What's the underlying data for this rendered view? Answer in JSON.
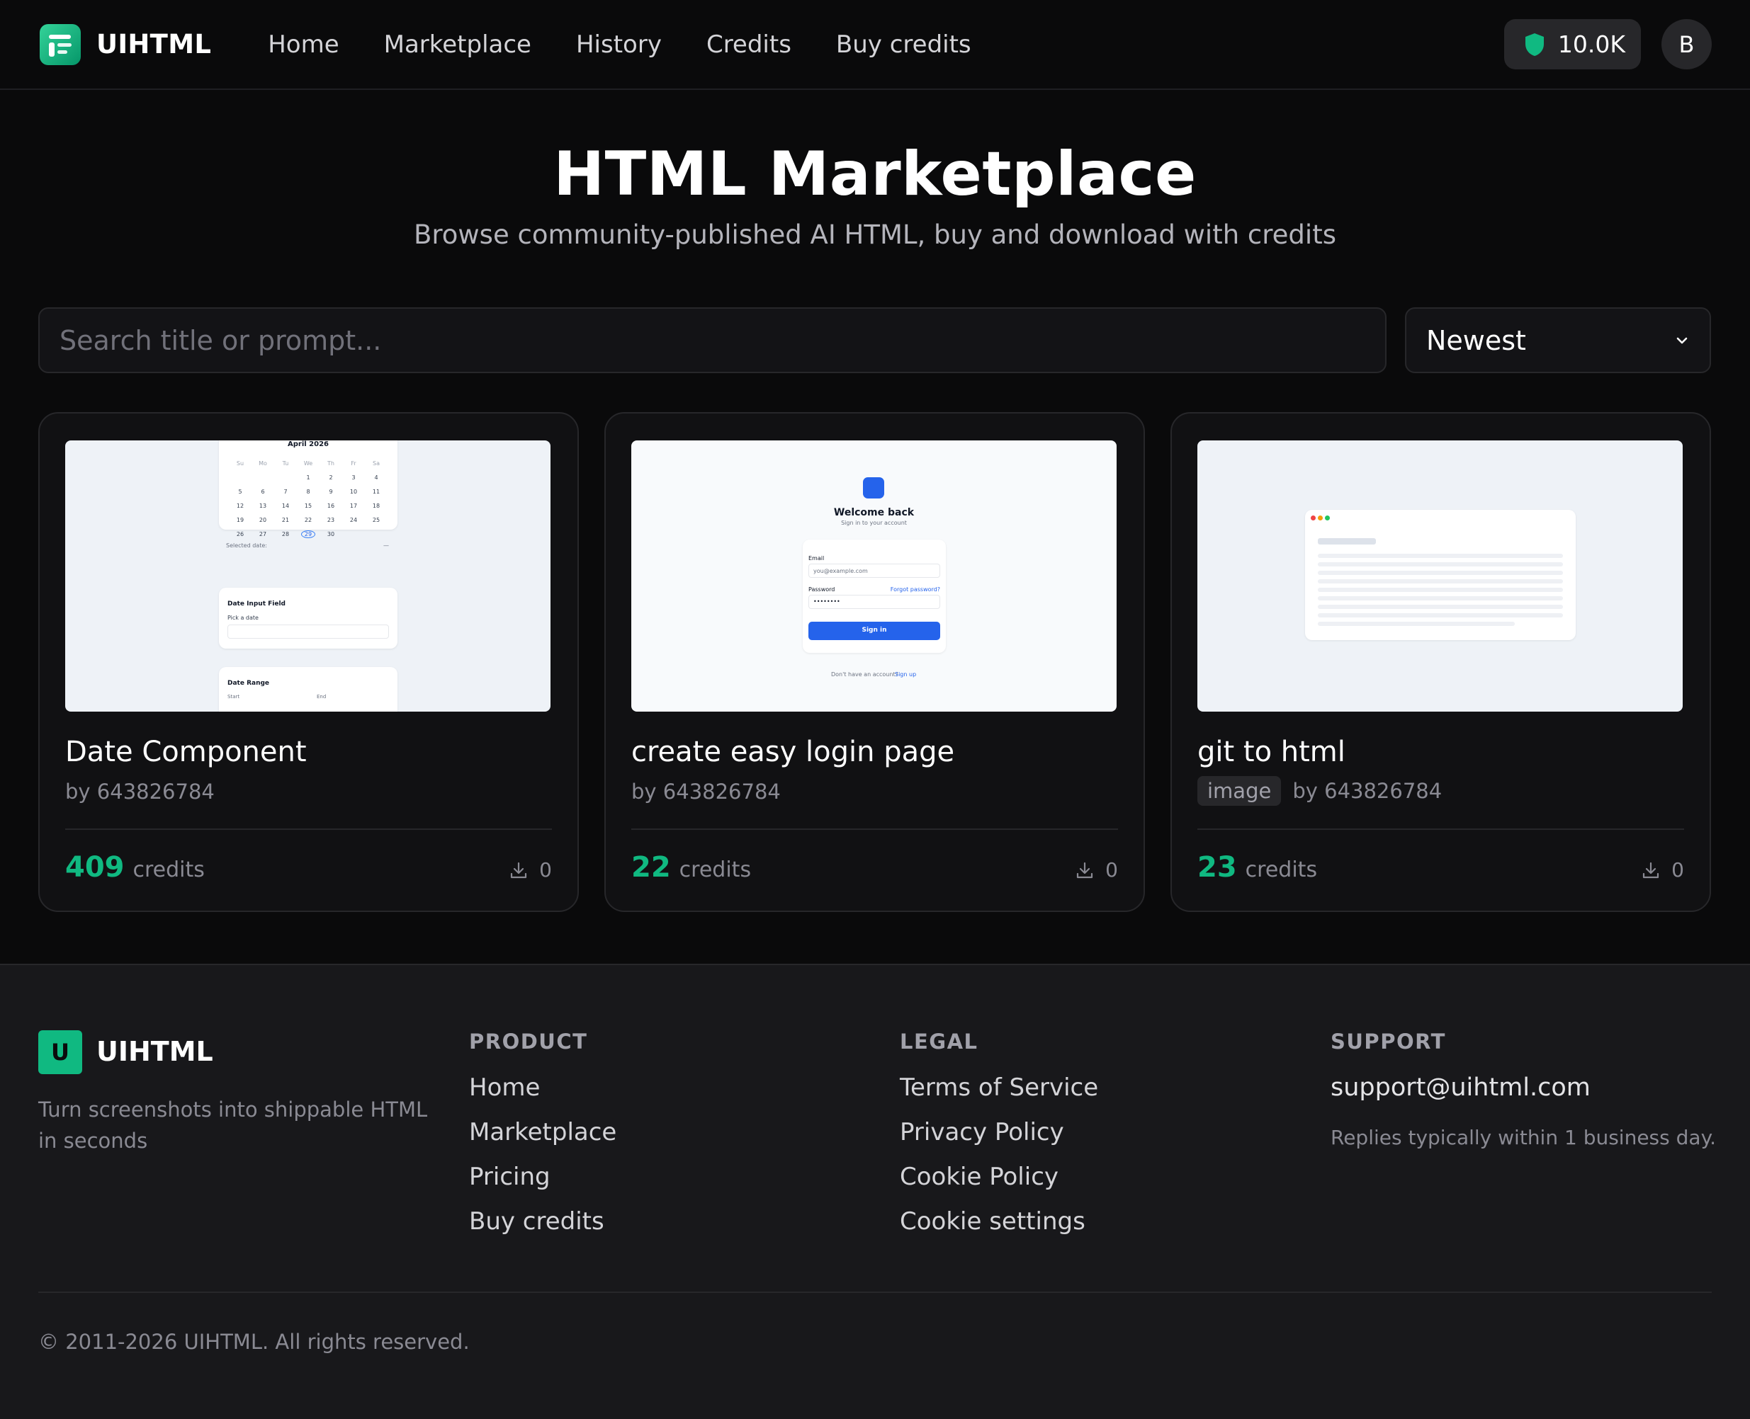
{
  "header": {
    "brand": "UIHTML",
    "nav": [
      "Home",
      "Marketplace",
      "History",
      "Credits",
      "Buy credits"
    ],
    "credits_balance": "10.0K",
    "avatar_initial": "B",
    "accent_color": "#10b981"
  },
  "hero": {
    "title": "HTML Marketplace",
    "subtitle": "Browse community-published AI HTML, buy and download with credits"
  },
  "search": {
    "placeholder": "Search title or prompt...",
    "value": ""
  },
  "sort": {
    "selected": "Newest"
  },
  "cards": [
    {
      "title": "Date Component",
      "tag": "",
      "author": "by 643826784",
      "price": "409",
      "price_unit": "credits",
      "downloads": "0",
      "preview": {
        "month": "April 2026",
        "weekdays": [
          "Su",
          "Mo",
          "Tu",
          "We",
          "Th",
          "Fr",
          "Sa"
        ],
        "weeks": [
          [
            "",
            "",
            "",
            "1",
            "2",
            "3",
            "4"
          ],
          [
            "5",
            "6",
            "7",
            "8",
            "9",
            "10",
            "11"
          ],
          [
            "12",
            "13",
            "14",
            "15",
            "16",
            "17",
            "18"
          ],
          [
            "19",
            "20",
            "21",
            "22",
            "23",
            "24",
            "25"
          ],
          [
            "26",
            "27",
            "28",
            "29",
            "30",
            "",
            ""
          ]
        ],
        "selected_label": "Selected date:",
        "selected_value": "—",
        "input_title": "Date Input Field",
        "input_label": "Pick a date",
        "range_title": "Date Range",
        "range_start": "Start",
        "range_end": "End"
      }
    },
    {
      "title": "create easy login page",
      "tag": "",
      "author": "by 643826784",
      "price": "22",
      "price_unit": "credits",
      "downloads": "0",
      "preview": {
        "heading": "Welcome back",
        "subheading": "Sign in to your account",
        "email_label": "Email",
        "email_value": "you@example.com",
        "password_label": "Password",
        "forgot": "Forgot password?",
        "password_value": "••••••••",
        "button": "Sign in",
        "footer_text": "Don't have an account?",
        "footer_link": "Sign up"
      }
    },
    {
      "title": "git to html",
      "tag": "image",
      "author": "by 643826784",
      "price": "23",
      "price_unit": "credits",
      "downloads": "0"
    }
  ],
  "footer": {
    "logo_letter": "U",
    "brand": "UIHTML",
    "tagline": "Turn screenshots into shippable HTML in seconds",
    "product": {
      "heading": "PRODUCT",
      "links": [
        "Home",
        "Marketplace",
        "Pricing",
        "Buy credits"
      ]
    },
    "legal": {
      "heading": "LEGAL",
      "links": [
        "Terms of Service",
        "Privacy Policy",
        "Cookie Policy",
        "Cookie settings"
      ]
    },
    "support": {
      "heading": "SUPPORT",
      "email": "support@uihtml.com",
      "note": "Replies typically within 1 business day."
    },
    "copyright": "© 2011-2026 UIHTML. All rights reserved."
  }
}
